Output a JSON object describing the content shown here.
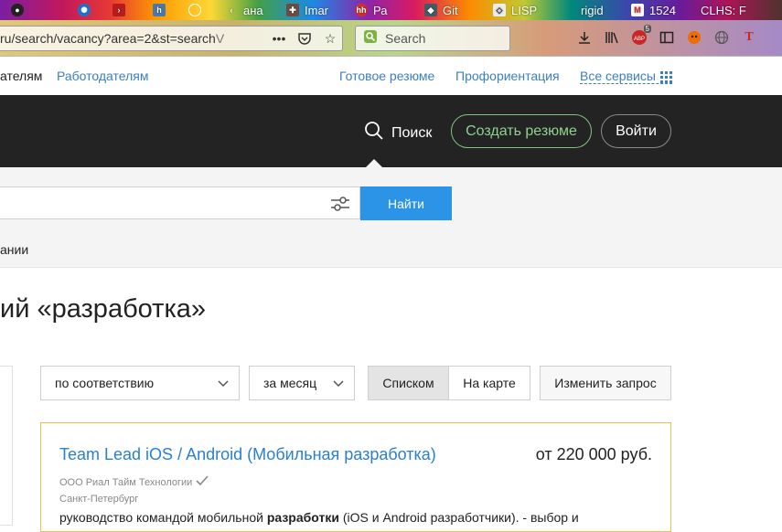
{
  "browser": {
    "tabs": [
      {
        "label": "",
        "icon": "github-icon"
      },
      {
        "label": "",
        "icon": "gear-blue-icon"
      },
      {
        "label": "",
        "icon": "terminal-icon"
      },
      {
        "label": "",
        "icon": "hh-square-icon"
      },
      {
        "label": "",
        "icon": "globe-icon"
      },
      {
        "label": "ана",
        "icon": "back-arrow-icon"
      },
      {
        "label": "Imar",
        "icon": "puzzle-icon"
      },
      {
        "label": "Ра",
        "icon": "hh-icon"
      },
      {
        "label": "Git",
        "icon": "git-icon"
      },
      {
        "label": "LISP",
        "icon": "lisp-icon"
      },
      {
        "label": "rigid",
        "icon": "drop-icon"
      },
      {
        "label": "1524",
        "icon": "gmail-icon"
      },
      {
        "label": "CLHS: F",
        "icon": ""
      }
    ],
    "url": {
      "main": "ru/search/vacancy?area=2&st=search",
      "faded": "V"
    },
    "search_placeholder": "Search",
    "adblock_badge": "5"
  },
  "topnav": {
    "applicants_partial": "ателям",
    "employers": "Работодателям",
    "ready_resume": "Готовое резюме",
    "career_guidance": "Профориентация",
    "all_services": "Все сервисы"
  },
  "header": {
    "search_label": "Поиск",
    "create_resume": "Создать резюме",
    "login": "Войти"
  },
  "searchpanel": {
    "find_button": "Найти",
    "advanced_partial": "ании"
  },
  "page_title": "ий «разработка»",
  "controls": {
    "sort": "по соответствию",
    "period": "за месяц",
    "view_list": "Списком",
    "view_map": "На карте",
    "change_query": "Изменить запрос"
  },
  "vacancy": {
    "title": "Team Lead iOS / Android (Мобильная разработка)",
    "salary": "от 220 000 руб.",
    "employer": "ООО Риал Тайм Технологии",
    "city": "Санкт-Петербург",
    "desc_before": "руководство командой мобильной ",
    "desc_bold": "разработки",
    "desc_after": " (iOS и Android разработчики). - выбор и"
  },
  "colors": {
    "header_bg": "#232323",
    "link_blue": "#3a7fc4",
    "find_button": "#2b94e6",
    "create_resume_green": "#8fd18f",
    "card_border": "#e8c15a"
  }
}
